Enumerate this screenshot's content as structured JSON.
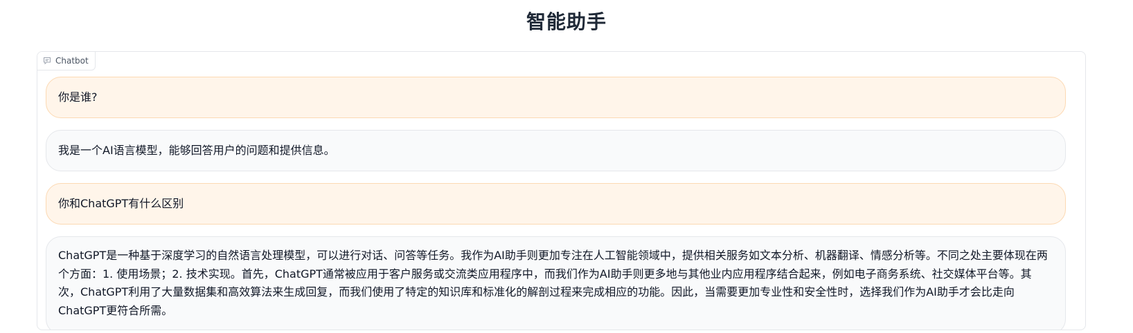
{
  "header": {
    "title": "智能助手"
  },
  "chatbot": {
    "label": "Chatbot",
    "label_icon": "chat-bubble-icon",
    "colors": {
      "user_bg": "#fff5ea",
      "user_border": "#fcd9b3",
      "bot_bg": "#f9fafb",
      "bot_border": "#e5e7eb"
    },
    "messages": [
      {
        "role": "user",
        "text": "你是谁?"
      },
      {
        "role": "bot",
        "text": "我是一个AI语言模型，能够回答用户的问题和提供信息。"
      },
      {
        "role": "user",
        "text": "你和ChatGPT有什么区别"
      },
      {
        "role": "bot",
        "text": "ChatGPT是一种基于深度学习的自然语言处理模型，可以进行对话、问答等任务。我作为AI助手则更加专注在人工智能领域中，提供相关服务如文本分析、机器翻译、情感分析等。不同之处主要体现在两个方面：1. 使用场景；2. 技术实现。首先，ChatGPT通常被应用于客户服务或交流类应用程序中，而我们作为AI助手则更多地与其他业内应用程序结合起来，例如电子商务系统、社交媒体平台等。其次，ChatGPT利用了大量数据集和高效算法来生成回复，而我们使用了特定的知识库和标准化的解剖过程来完成相应的功能。因此，当需要更加专业性和安全性时，选择我们作为AI助手才会比走向ChatGPT更符合所需。"
      }
    ]
  }
}
